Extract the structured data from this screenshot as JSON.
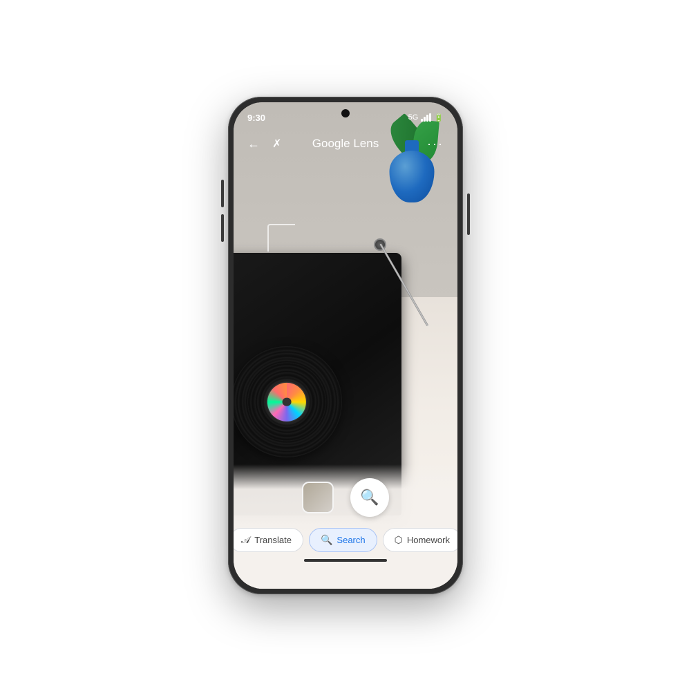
{
  "phone": {
    "statusBar": {
      "time": "9:30",
      "network": "5G"
    },
    "topNav": {
      "title": "Google Lens",
      "backLabel": "←",
      "flashLabel": "✗",
      "moreLabel": "···"
    },
    "bottomBar": {
      "tabs": [
        {
          "id": "translate",
          "label": "Translate",
          "icon": "A→",
          "active": false
        },
        {
          "id": "search",
          "label": "Search",
          "icon": "🔍",
          "active": true
        },
        {
          "id": "homework",
          "label": "Homework",
          "icon": "⬡",
          "active": false
        }
      ],
      "homeIndicator": ""
    }
  }
}
